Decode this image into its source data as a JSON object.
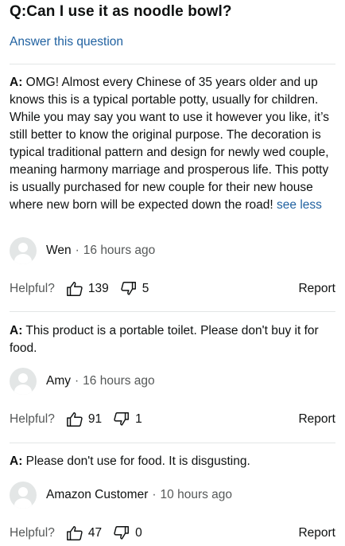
{
  "question": {
    "label": "Q:Can I use it as noodle bowl?",
    "answer_link": "Answer this question"
  },
  "answers": [
    {
      "prefix": "A:",
      "text": "OMG!  Almost every Chinese of 35 years older and up knows this is a typical portable potty, usually for children. While you may say you want to use it however you like, it’s still better to know the original purpose. The decoration is typical traditional pattern and design for newly wed couple, meaning harmony marriage and prosperous life. This potty is usually purchased for new couple for their new house where new born will be expected down the road!",
      "see_less": "see less",
      "author": "Wen",
      "sep": "·",
      "time": "16 hours ago",
      "helpful_label": "Helpful?",
      "up": "139",
      "down": "5",
      "report": "Report"
    },
    {
      "prefix": "A:",
      "text": "This product is a portable toilet. Please don't buy it for food.",
      "author": "Amy",
      "sep": "·",
      "time": "16 hours ago",
      "helpful_label": "Helpful?",
      "up": "91",
      "down": "1",
      "report": "Report"
    },
    {
      "prefix": "A:",
      "text": "Please don't use for food. It is disgusting.",
      "author": "Amazon Customer",
      "sep": "·",
      "time": "10 hours ago",
      "helpful_label": "Helpful?",
      "up": "47",
      "down": "0",
      "report": "Report"
    }
  ]
}
